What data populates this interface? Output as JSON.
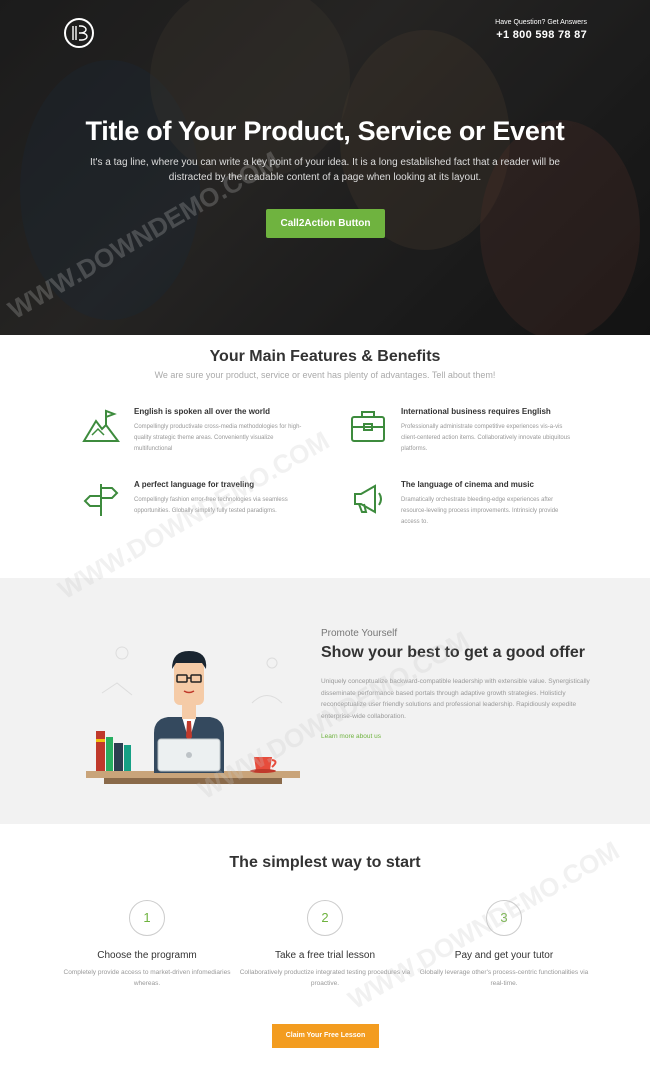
{
  "header": {
    "question": "Have Question? Get Answers",
    "phone": "+1 800 598 78 87"
  },
  "hero": {
    "title": "Title of Your Product, Service or Event",
    "tagline": "It's a tag line, where you can write a key point of your idea. It is a long established fact that a reader will be distracted by the readable content of a page when looking at its layout.",
    "cta": "Call2Action Button"
  },
  "features": {
    "title": "Your Main Features & Benefits",
    "subtitle": "We are sure your product, service or event has plenty of advantages. Tell about them!",
    "items": [
      {
        "icon": "mountain-flag-icon",
        "title": "English is spoken all over the world",
        "desc": "Compellingly productivate cross-media methodologies for high-quality strategic theme areas. Conveniently visualize multifunctional"
      },
      {
        "icon": "briefcase-icon",
        "title": "International business requires English",
        "desc": "Professionally administrate competitive experiences vis-a-vis client-centered action items. Collaboratively innovate ubiquitous platforms."
      },
      {
        "icon": "signpost-icon",
        "title": "A perfect language for traveling",
        "desc": "Compellingly fashion error-free technologies via seamless opportunities. Globally simplify fully tested paradigms."
      },
      {
        "icon": "megaphone-icon",
        "title": "The language of cinema and music",
        "desc": "Dramatically orchestrate bleeding-edge experiences after resource-leveling process improvements. Intrinsicly provide access to."
      }
    ]
  },
  "promo": {
    "kicker": "Promote Yourself",
    "title": "Show your best to get a good offer",
    "text": "Uniquely conceptualize backward-compatible leadership with extensible value. Synergistically disseminate performance based portals through adaptive growth strategies. Holisticly reconceptualize user friendly solutions and professional leadership. Rapidiously expedite enterprise-wide collaboration.",
    "link": "Learn more about us"
  },
  "steps": {
    "title": "The simplest way to start",
    "items": [
      {
        "num": "1",
        "title": "Choose the programm",
        "desc": "Completely provide access to market-driven infomediaries whereas."
      },
      {
        "num": "2",
        "title": "Take a free trial lesson",
        "desc": "Collaboratively productize integrated testing procedures via proactive."
      },
      {
        "num": "3",
        "title": "Pay and get your tutor",
        "desc": "Globally leverage other's process-centric functionalities via real-time."
      }
    ],
    "claim": "Claim Your Free Lesson"
  },
  "watermark": "WWW.DOWNDEMO.COM",
  "colors": {
    "accent": "#6fb33f",
    "orange": "#f39c1f",
    "icon": "#3d8b3d"
  }
}
